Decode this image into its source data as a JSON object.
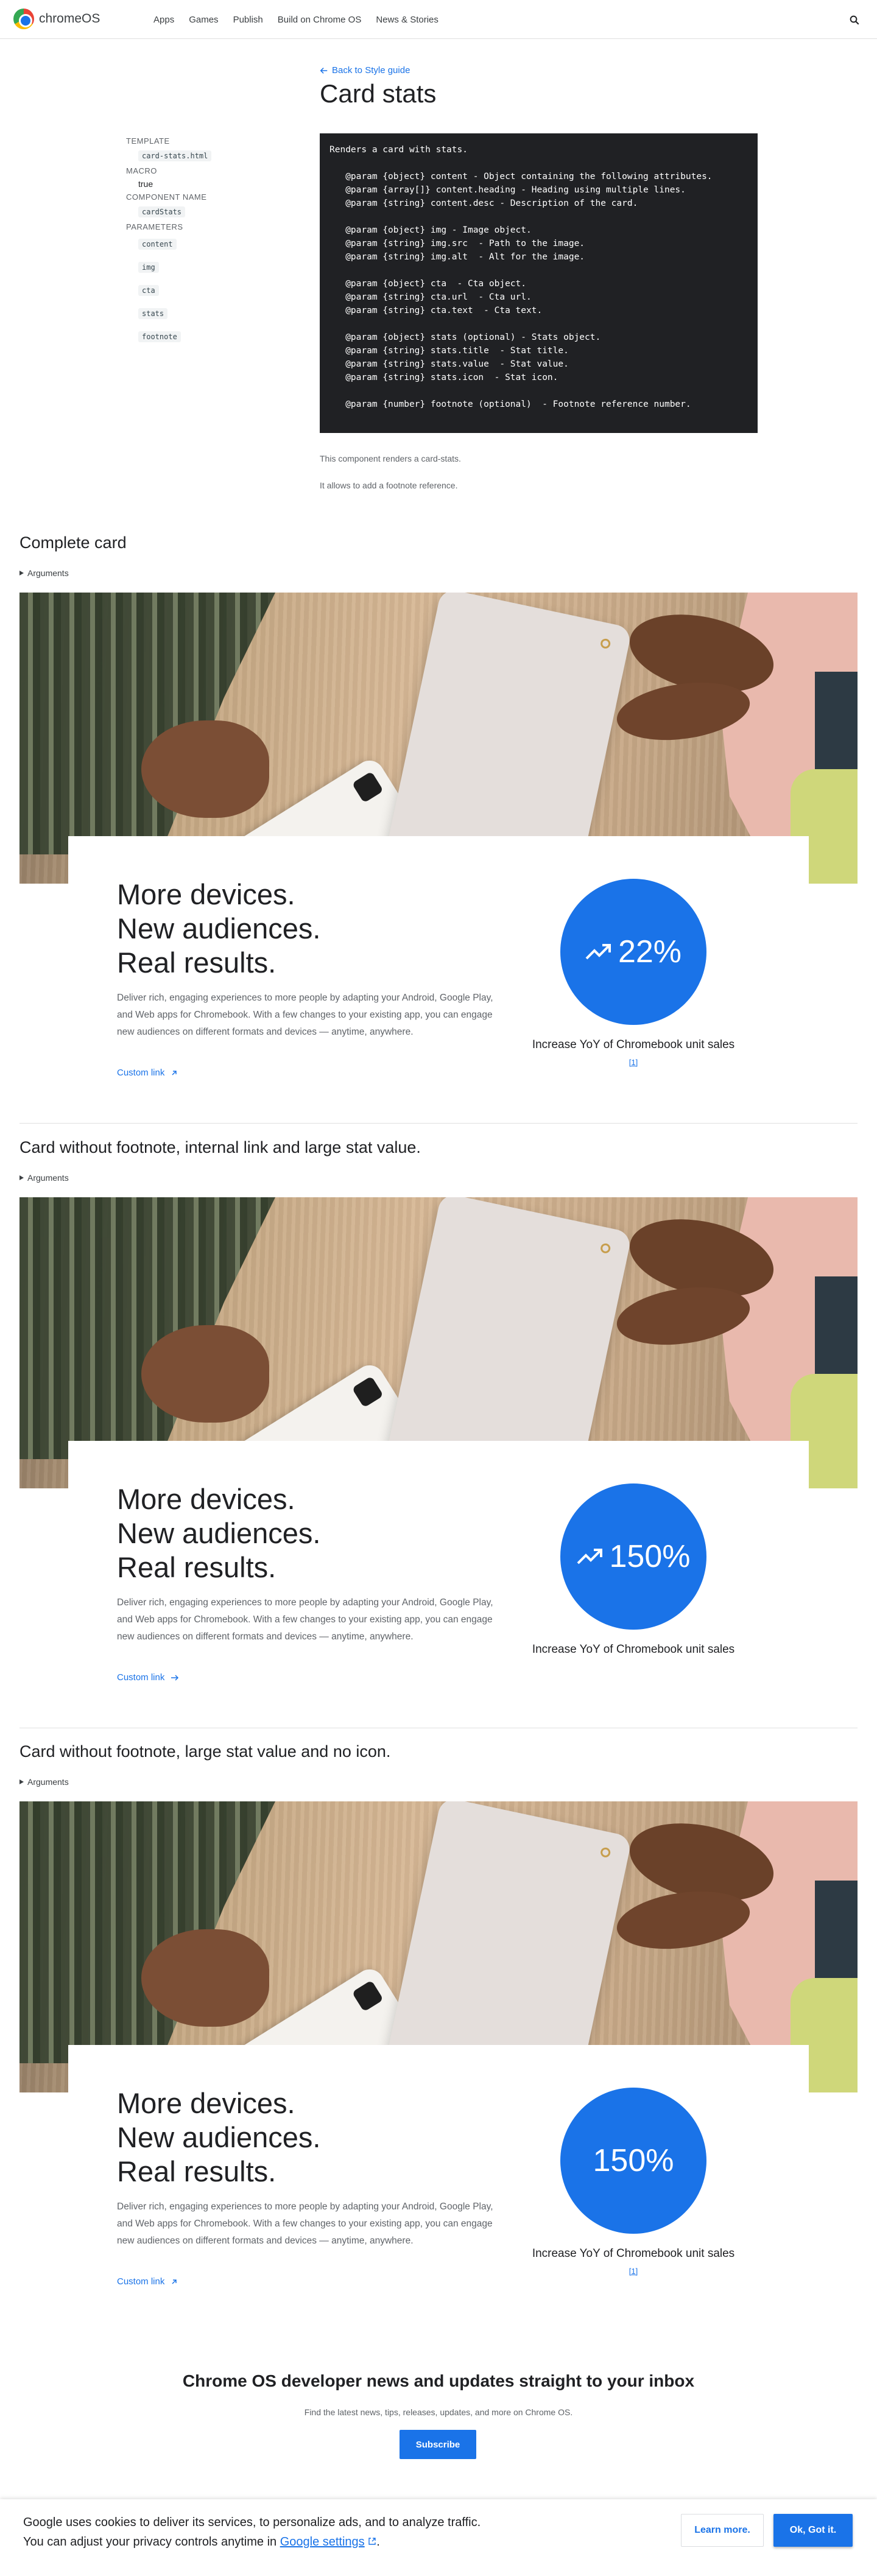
{
  "header": {
    "brand": "chromeOS",
    "nav": [
      "Apps",
      "Games",
      "Publish",
      "Build on Chrome OS",
      "News & Stories"
    ]
  },
  "intro": {
    "back_link": "Back to Style guide",
    "title": "Card stats",
    "meta": {
      "template_label": "TEMPLATE",
      "template_value": "card-stats.html",
      "macro_label": "MACRO",
      "macro_value": "true",
      "component_label": "COMPONENT NAME",
      "component_value": "cardStats",
      "parameters_label": "PARAMETERS",
      "parameters": [
        "content",
        "img",
        "cta",
        "stats",
        "footnote"
      ]
    },
    "code": "Renders a card with stats.\n\n   @param {object} content - Object containing the following attributes.\n   @param {array[]} content.heading - Heading using multiple lines.\n   @param {string} content.desc - Description of the card.\n\n   @param {object} img - Image object.\n   @param {string} img.src  - Path to the image.\n   @param {string} img.alt  - Alt for the image.\n\n   @param {object} cta  - Cta object.\n   @param {string} cta.url  - Cta url.\n   @param {string} cta.text  - Cta text.\n\n   @param {object} stats (optional) - Stats object.\n   @param {string} stats.title  - Stat title.\n   @param {string} stats.value  - Stat value.\n   @param {string} stats.icon  - Stat icon.\n\n   @param {number} footnote (optional)  - Footnote reference number.",
    "desc1": "This component renders a card-stats.",
    "desc2": "It allows to add a footnote reference."
  },
  "sections": [
    {
      "title": "Complete card",
      "args": "Arguments",
      "card": {
        "heading": [
          "More devices.",
          "New audiences.",
          "Real results."
        ],
        "desc": "Deliver rich, engaging experiences to more people by adapting your Android, Google Play, and Web apps for Chromebook. With a few changes to your existing app, you can engage new audiences on different formats and devices — anytime, anywhere.",
        "cta": "Custom link",
        "cta_icon": "external-link-icon",
        "stat_value": "22%",
        "stat_icon": "trending-up-icon",
        "stat_title": "Increase YoY of Chromebook unit sales",
        "footnote": "[1]"
      }
    },
    {
      "title": "Card without footnote, internal link and large stat value.",
      "args": "Arguments",
      "card": {
        "heading": [
          "More devices.",
          "New audiences.",
          "Real results."
        ],
        "desc": "Deliver rich, engaging experiences to more people by adapting your Android, Google Play, and Web apps for Chromebook. With a few changes to your existing app, you can engage new audiences on different formats and devices — anytime, anywhere.",
        "cta": "Custom link",
        "cta_icon": "arrow-right-icon",
        "stat_value": "150%",
        "stat_icon": "trending-up-icon",
        "stat_title": "Increase YoY of Chromebook unit sales",
        "footnote": ""
      }
    },
    {
      "title": "Card without footnote, large stat value and no icon.",
      "args": "Arguments",
      "card": {
        "heading": [
          "More devices.",
          "New audiences.",
          "Real results."
        ],
        "desc": "Deliver rich, engaging experiences to more people by adapting your Android, Google Play, and Web apps for Chromebook. With a few changes to your existing app, you can engage new audiences on different formats and devices — anytime, anywhere.",
        "cta": "Custom link",
        "cta_icon": "external-link-icon",
        "stat_value": "150%",
        "stat_icon": "",
        "stat_title": "Increase YoY of Chromebook unit sales",
        "footnote": "[1]"
      }
    }
  ],
  "newsletter": {
    "title": "Chrome OS developer news and updates straight to your inbox",
    "subtitle": "Find the latest news, tips, releases, updates, and more on Chrome OS.",
    "button": "Subscribe"
  },
  "cookie": {
    "line1": "Google uses cookies to deliver its services, to personalize ads, and to analyze traffic.",
    "line2_prefix": "You can adjust your privacy controls anytime in ",
    "line2_link": "Google settings",
    "line2_suffix": ".",
    "learn_more": "Learn more.",
    "ok": "Ok, Got it."
  },
  "colors": {
    "accent": "#1a73e8",
    "code_bg": "#202124"
  }
}
